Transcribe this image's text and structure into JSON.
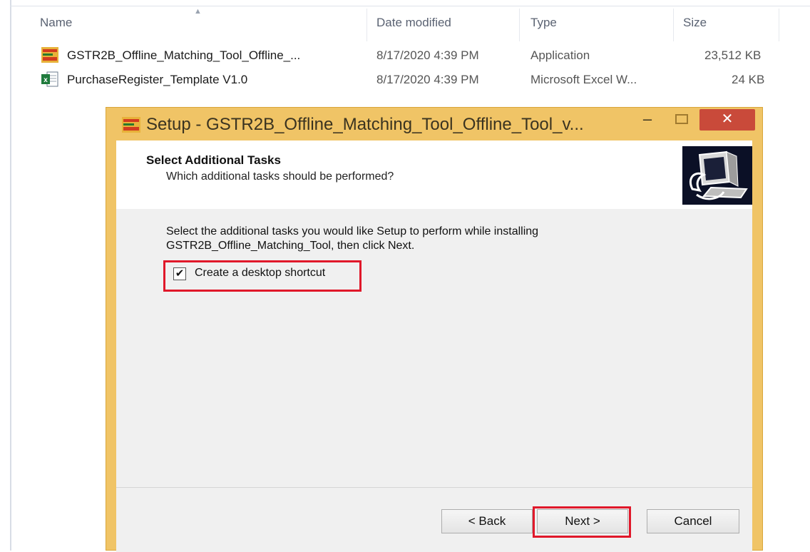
{
  "explorer": {
    "columns": {
      "name": "Name",
      "date_modified": "Date modified",
      "type": "Type",
      "size": "Size"
    },
    "files": [
      {
        "icon": "installer-app-icon",
        "name": "GSTR2B_Offline_Matching_Tool_Offline_...",
        "date": "8/17/2020 4:39 PM",
        "type": "Application",
        "size": "23,512 KB"
      },
      {
        "icon": "excel-file-icon",
        "name": "PurchaseRegister_Template V1.0",
        "date": "8/17/2020 4:39 PM",
        "type": "Microsoft Excel W...",
        "size": "24 KB"
      }
    ]
  },
  "dialog": {
    "title": "Setup - GSTR2B_Offline_Matching_Tool_Offline_Tool_v...",
    "controls": {
      "minimize": "–",
      "close": "✕"
    },
    "header": {
      "title": "Select Additional Tasks",
      "subtitle": "Which additional tasks should be performed?"
    },
    "body": {
      "instructions": "Select the additional tasks you would like Setup to perform while installing GSTR2B_Offline_Matching_Tool, then click Next.",
      "tasks": [
        {
          "label": "Create a desktop shortcut",
          "checked": true,
          "check_glyph": "✔"
        }
      ]
    },
    "buttons": {
      "back": "< Back",
      "next": "Next >",
      "cancel": "Cancel"
    }
  },
  "colors": {
    "window_frame": "#f0c466",
    "close_button": "#c94a3a",
    "highlight": "#e0182a"
  }
}
